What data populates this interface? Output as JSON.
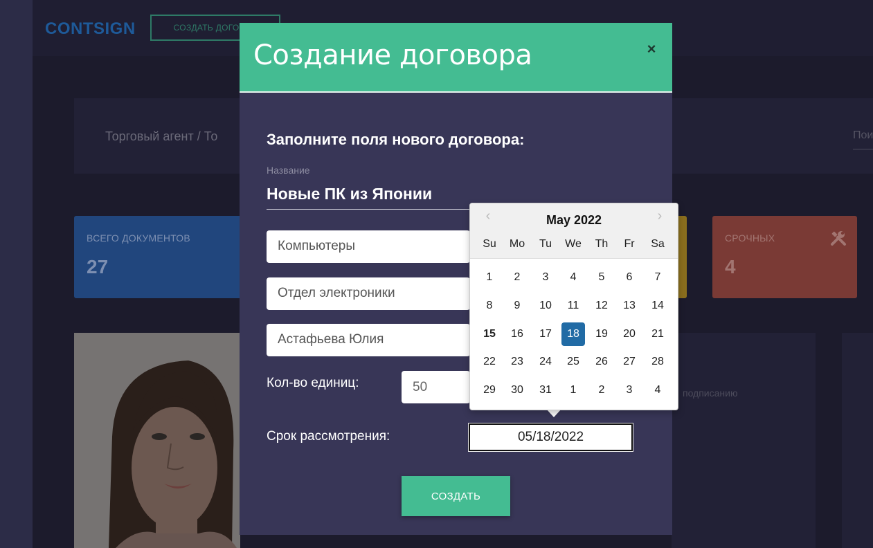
{
  "app": {
    "logo": "CONTSIGN",
    "create_button": "СОЗДАТЬ ДОГОВОР"
  },
  "breadcrumb": "Торговый агент / То",
  "search_placeholder": "Пои",
  "stats": {
    "total": {
      "label": "ВСЕГО ДОКУМЕНТОВ",
      "value": "27"
    },
    "urgent": {
      "label": "СРОЧНЫХ",
      "value": "4"
    }
  },
  "background_text": {
    "signing": "подписанию"
  },
  "modal": {
    "title": "Создание договора",
    "close": "×",
    "heading": "Заполните поля нового договора:",
    "name_label": "Название",
    "name_value": "Новые ПК из Японии",
    "category": "Компьютеры",
    "department": "Отдел электроники",
    "person": "Астафьева Юлия",
    "qty_label": "Кол-во единиц:",
    "qty_value": "50",
    "deadline_label": "Срок рассмотрения:",
    "deadline_value": "05/18/2022",
    "submit": "СОЗДАТЬ"
  },
  "datepicker": {
    "month": "May 2022",
    "prev": "‹",
    "next": "›",
    "weekdays": [
      "Su",
      "Mo",
      "Tu",
      "We",
      "Th",
      "Fr",
      "Sa"
    ],
    "days": [
      "1",
      "2",
      "3",
      "4",
      "5",
      "6",
      "7",
      "8",
      "9",
      "10",
      "11",
      "12",
      "13",
      "14",
      "15",
      "16",
      "17",
      "18",
      "19",
      "20",
      "21",
      "22",
      "23",
      "24",
      "25",
      "26",
      "27",
      "28",
      "29",
      "30",
      "31",
      "1",
      "2",
      "3",
      "4"
    ],
    "today": "15",
    "selected": "18"
  }
}
